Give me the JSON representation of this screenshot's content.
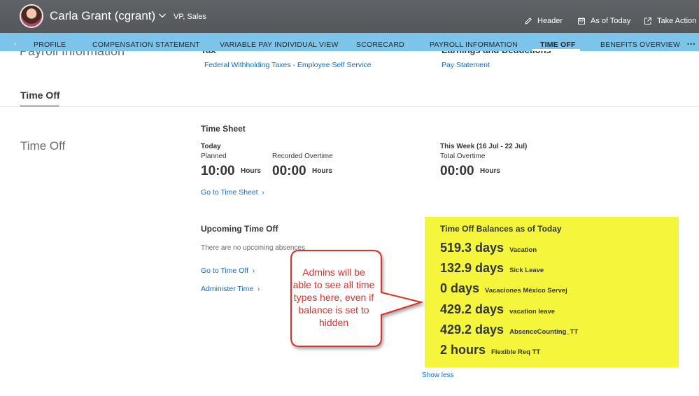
{
  "header": {
    "user_name": "Carla Grant (cgrant)",
    "user_role": "VP, Sales",
    "actions": [
      {
        "label": "Header",
        "icon": "pencil-icon"
      },
      {
        "label": "As of Today",
        "icon": "calendar-icon"
      },
      {
        "label": "Take Action",
        "icon": "external-link-icon"
      }
    ]
  },
  "tabs": [
    {
      "label": "PROFILE",
      "active": false
    },
    {
      "label": "COMPENSATION STATEMENT",
      "active": false
    },
    {
      "label": "VARIABLE PAY INDIVIDUAL VIEW",
      "active": false
    },
    {
      "label": "SCORECARD",
      "active": false
    },
    {
      "label": "PAYROLL INFORMATION",
      "active": false
    },
    {
      "label": "TIME OFF",
      "active": true
    },
    {
      "label": "BENEFITS OVERVIEW",
      "active": false
    }
  ],
  "tabs_more": "•••",
  "partial_row": {
    "left_title": "Payroll Information",
    "mid_title": "Tax",
    "mid_link": "Federal Withholding Taxes - Employee Self Service",
    "right_title": "Earnings and Deductions",
    "right_link": "Pay Statement"
  },
  "section": {
    "title": "Time Off",
    "block_title": "Time Off"
  },
  "time_sheet": {
    "title": "Time Sheet",
    "today_label": "Today",
    "planned_label": "Planned",
    "planned_value": "10:00",
    "planned_unit": "Hours",
    "recorded_ot_label": "Recorded Overtime",
    "recorded_ot_value": "00:00",
    "recorded_ot_unit": "Hours",
    "week_label": "This Week (16 Jul - 22 Jul)",
    "total_ot_label": "Total Overtime",
    "total_ot_value": "00:00",
    "total_ot_unit": "Hours",
    "link": "Go to Time Sheet"
  },
  "upcoming": {
    "title": "Upcoming Time Off",
    "empty_text": "There are no upcoming absences",
    "link_time_off": "Go to Time Off",
    "link_administer": "Administer Time"
  },
  "balances": {
    "title": "Time Off Balances as of Today",
    "highlight_color": "#f5f53c",
    "items": [
      {
        "amount": "519.3 days",
        "type": "Vacation"
      },
      {
        "amount": "132.9 days",
        "type": "Sick Leave"
      },
      {
        "amount": "0 days",
        "type": "Vacaciones México Servej"
      },
      {
        "amount": "429.2 days",
        "type": "vacation leave"
      },
      {
        "amount": "429.2 days",
        "type": "AbsenceCounting_TT"
      },
      {
        "amount": "2 hours",
        "type": "Flexible Req TT"
      }
    ],
    "show_less": "Show less"
  },
  "callout": {
    "text": "Admins will be able to see all time types here, even if balance is set to hidden",
    "border_color": "#d9312c"
  },
  "colors": {
    "header_bg": "#5a5d61",
    "tab_bar_bg": "#7dc4ea",
    "link": "#0a6ed1"
  }
}
